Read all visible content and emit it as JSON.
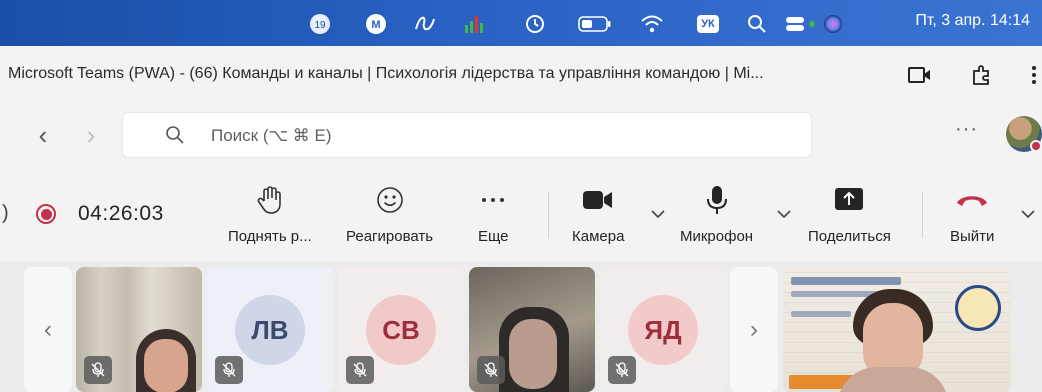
{
  "menubar": {
    "badge_number": "19",
    "date_time": "Пт, 3 апр.  14:14",
    "keyboard_layout": "УК"
  },
  "window": {
    "title": "Microsoft Teams (PWA) - (66) Команды и каналы | Психологія лідерства та управління командою | Mi..."
  },
  "nav": {
    "back": "‹",
    "forward": "›",
    "search_placeholder": "Поиск (⌥ ⌘ E)",
    "more": "···"
  },
  "meeting": {
    "timer": "04:26:03",
    "edge_glyph": ")",
    "tools": [
      {
        "label": "Поднять р...",
        "icon": "raise-hand-icon"
      },
      {
        "label": "Реагировать",
        "icon": "smiley-icon"
      },
      {
        "label": "Еще",
        "icon": "more-icon"
      },
      {
        "label": "Камера",
        "icon": "camera-icon"
      },
      {
        "label": "Микрофон",
        "icon": "mic-icon"
      },
      {
        "label": "Поделиться",
        "icon": "share-icon"
      },
      {
        "label": "Выйти",
        "icon": "hang-up-icon"
      }
    ]
  },
  "participants": {
    "prev": "‹",
    "next": "›",
    "tiles": [
      {
        "kind": "video"
      },
      {
        "kind": "initials",
        "initials": "ЛВ",
        "bg": "#eef0f8",
        "avatar_bg": "#cfd6e8",
        "fg": "#3b4a6b"
      },
      {
        "kind": "initials",
        "initials": "СВ",
        "bg": "#f3eded",
        "avatar_bg": "#f2c9c9",
        "fg": "#9e2f3a"
      },
      {
        "kind": "video"
      },
      {
        "kind": "initials",
        "initials": "ЯД",
        "bg": "#f1eded",
        "avatar_bg": "#f3caca",
        "fg": "#9e2f3a"
      },
      {
        "kind": "video"
      }
    ]
  },
  "colors": {
    "record": "#c4314b",
    "hangup": "#c4314b",
    "menubar": "#2a62c4"
  }
}
